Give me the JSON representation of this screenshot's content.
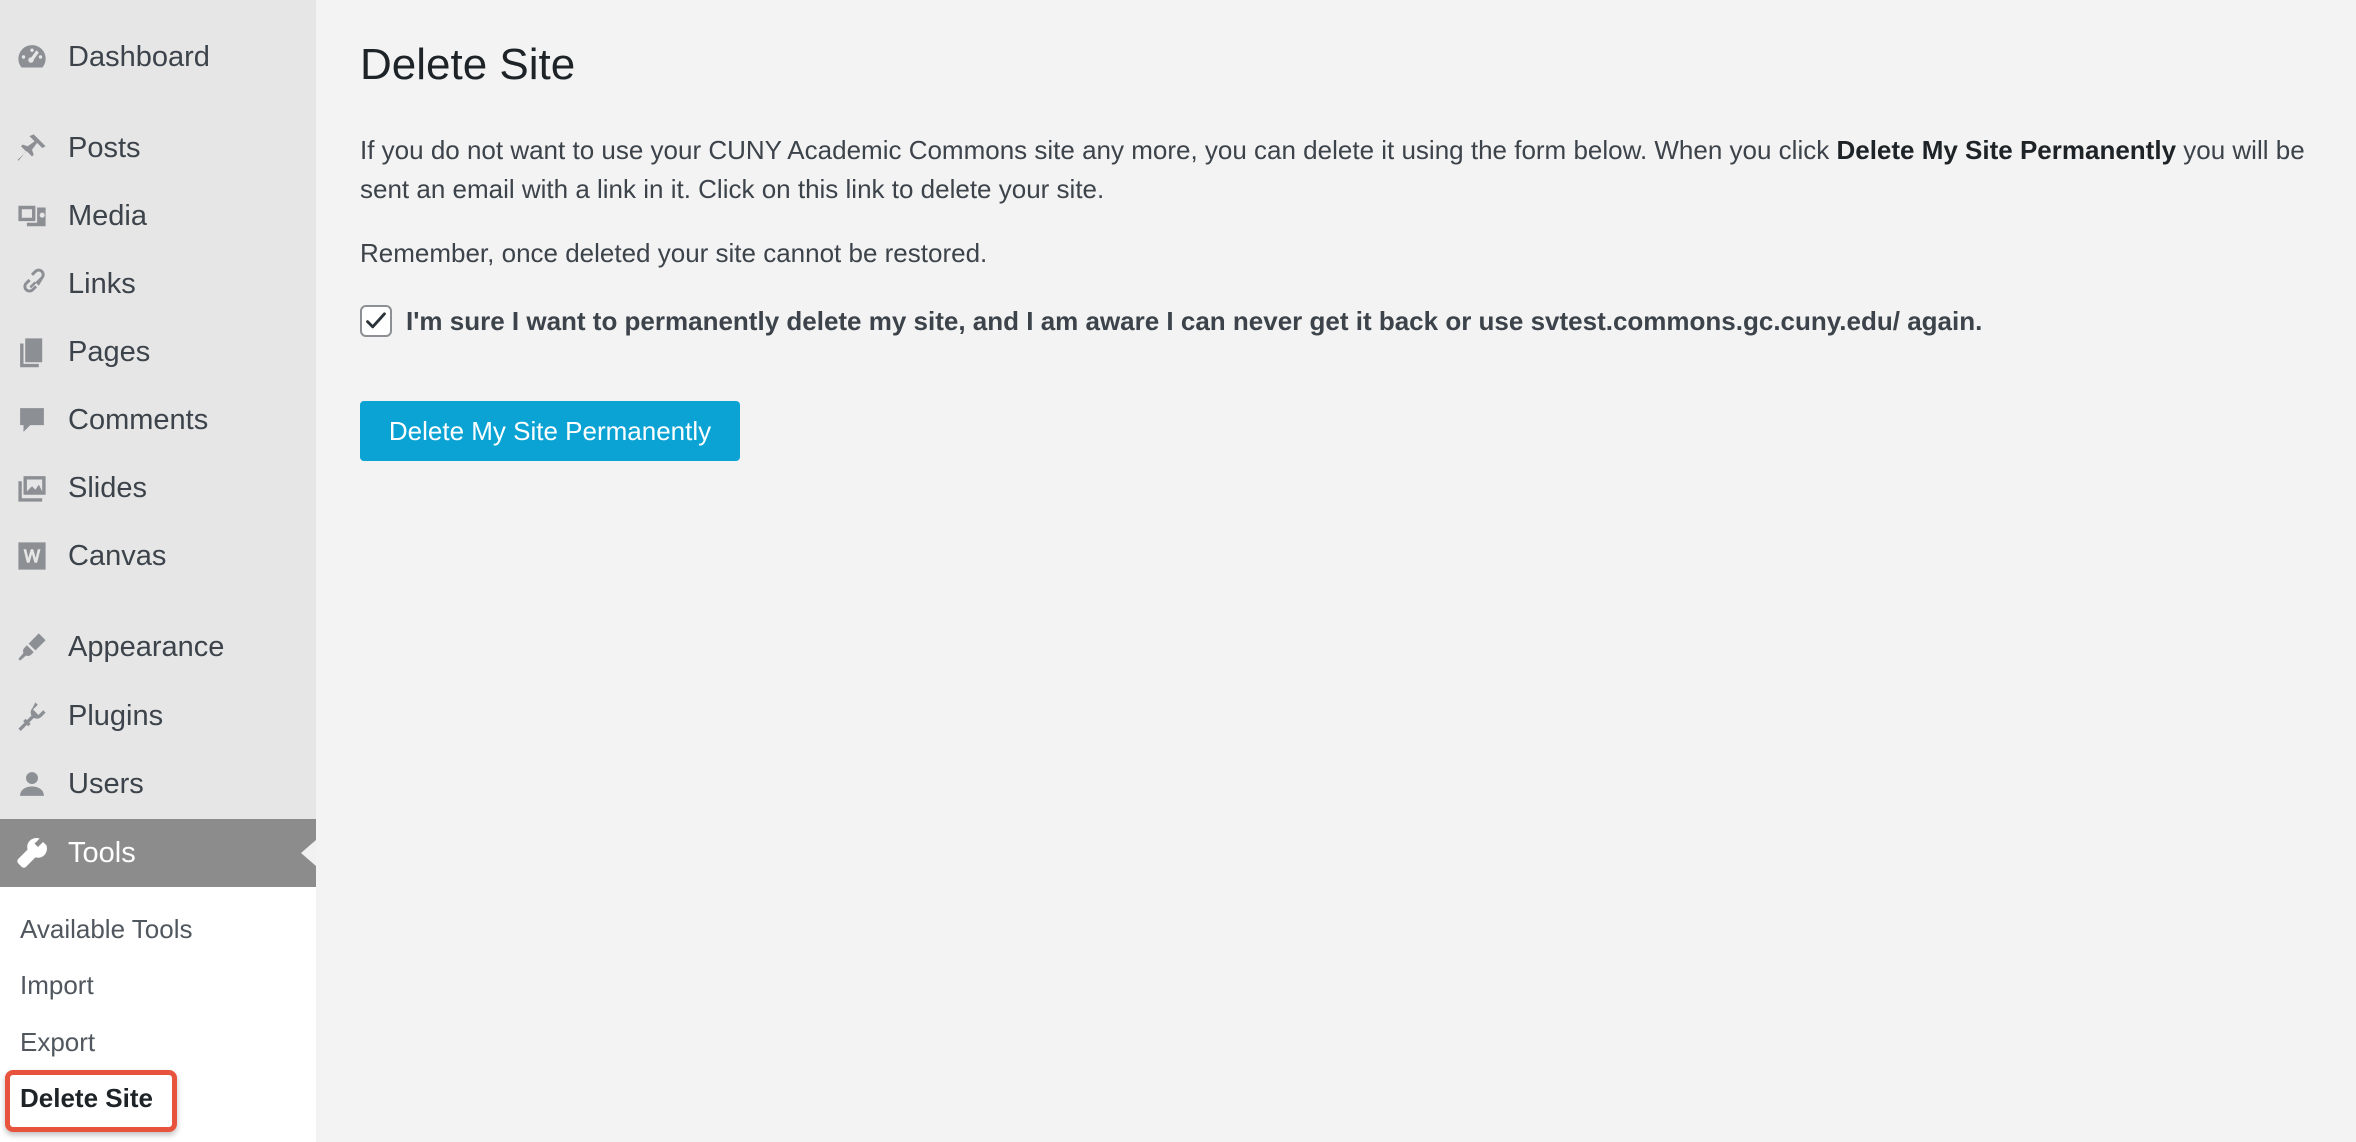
{
  "sidebar": {
    "items": [
      {
        "label": "Dashboard",
        "icon": "dashboard-icon"
      },
      {
        "label": "Posts",
        "icon": "pushpin-icon"
      },
      {
        "label": "Media",
        "icon": "media-icon"
      },
      {
        "label": "Links",
        "icon": "link-icon"
      },
      {
        "label": "Pages",
        "icon": "pages-icon"
      },
      {
        "label": "Comments",
        "icon": "comment-icon"
      },
      {
        "label": "Slides",
        "icon": "slides-icon"
      },
      {
        "label": "Canvas",
        "icon": "canvas-w-icon"
      },
      {
        "label": "Appearance",
        "icon": "paintbrush-icon"
      },
      {
        "label": "Plugins",
        "icon": "plugin-icon"
      },
      {
        "label": "Users",
        "icon": "user-icon"
      },
      {
        "label": "Tools",
        "icon": "wrench-icon",
        "active": true
      }
    ],
    "submenu": [
      {
        "label": "Available Tools"
      },
      {
        "label": "Import"
      },
      {
        "label": "Export"
      },
      {
        "label": "Delete Site",
        "current": true
      }
    ]
  },
  "main": {
    "title": "Delete Site",
    "intro_part1": "If you do not want to use your CUNY Academic Commons site any more, you can delete it using the form below. When you click ",
    "intro_bold": "Delete My Site Permanently",
    "intro_part2": " you will be sent an email with a link in it. Click on this link to delete your site.",
    "reminder": "Remember, once deleted your site cannot be restored.",
    "confirm_label": "I'm sure I want to permanently delete my site, and I am aware I can never get it back or use svtest.commons.gc.cuny.edu/ again.",
    "confirm_checked": true,
    "submit_label": "Delete My Site Permanently"
  },
  "colors": {
    "sidebar_bg": "#e6e6e6",
    "active_bg": "#8c8c8c",
    "button_bg": "#0aa3d4",
    "highlight": "#e8533d"
  }
}
